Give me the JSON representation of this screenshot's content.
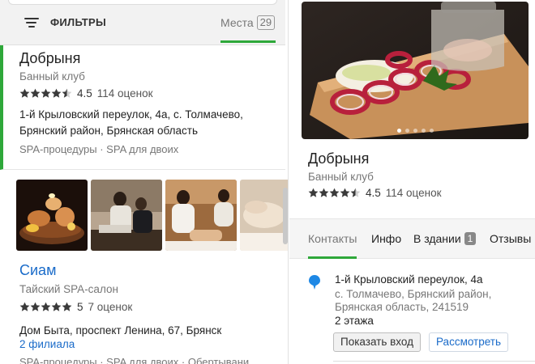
{
  "left": {
    "filters_label": "ФИЛЬТРЫ",
    "tab_places": {
      "label": "Места",
      "count": "29"
    },
    "card1": {
      "title": "Добрыня",
      "category": "Банный клуб",
      "rating": "4.5",
      "rating_stars": 4.5,
      "reviews": "114 оценок",
      "address": "1-й Крыловский переулок, 4а, с. Толмачево, Брянский район, Брянская область",
      "tags": "SPA-процедуры · SPA для двоих"
    },
    "card2": {
      "title": "Сиам",
      "category": "Тайский SPA-салон",
      "rating": "5",
      "rating_stars": 5,
      "reviews": "7 оценок",
      "address": "Дом Быта, проспект Ленина, 67, Брянск",
      "branches": "2 филиала",
      "tags": "SPA-процедуры · SPA для двоих · Обертывани"
    }
  },
  "right": {
    "title": "Добрыня",
    "category": "Банный клуб",
    "rating": "4.5",
    "rating_stars": 4.5,
    "reviews": "114 оценок",
    "tabs": [
      {
        "label": "Контакты"
      },
      {
        "label": "Инфо"
      },
      {
        "label": "В здании",
        "badge": "1"
      },
      {
        "label": "Отзывы"
      }
    ],
    "address_line1": "1-й Крыловский переулок, 4а",
    "address_line2": "с. Толмачево, Брянский район, Брянская область, 241519",
    "floors": "2 этажа",
    "btn_show_entrance": "Показать вход",
    "btn_view": "Рассмотреть"
  },
  "colors": {
    "accent_green": "#2ea83a",
    "link_blue": "#1a6bc9",
    "pin_blue": "#1e88e5"
  }
}
